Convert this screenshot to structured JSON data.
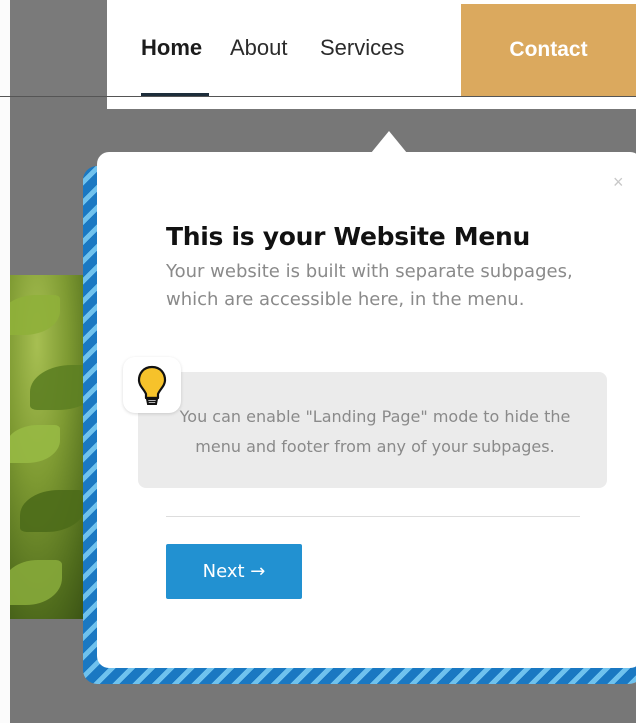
{
  "nav": {
    "items": [
      {
        "label": "Home",
        "active": true
      },
      {
        "label": "About",
        "active": false
      },
      {
        "label": "Services",
        "active": false
      }
    ],
    "contact_label": "Contact"
  },
  "popover": {
    "title": "This is your Website Menu",
    "body": "Your website is built with separate subpages, which are accessible here, in the menu.",
    "tip_icon": "lightbulb-icon",
    "tip_text": "You can enable \"Landing Page\" mode to hide the menu and footer from any of your subpages.",
    "close_icon": "close-icon",
    "close_glyph": "×",
    "next_label": "Next →"
  },
  "colors": {
    "contact_bg": "#dba95e",
    "next_bg": "#2291d1",
    "stripe_dark": "#1a78c2",
    "stripe_light": "#6fc2ee",
    "overlay": "#7a7a7a"
  }
}
